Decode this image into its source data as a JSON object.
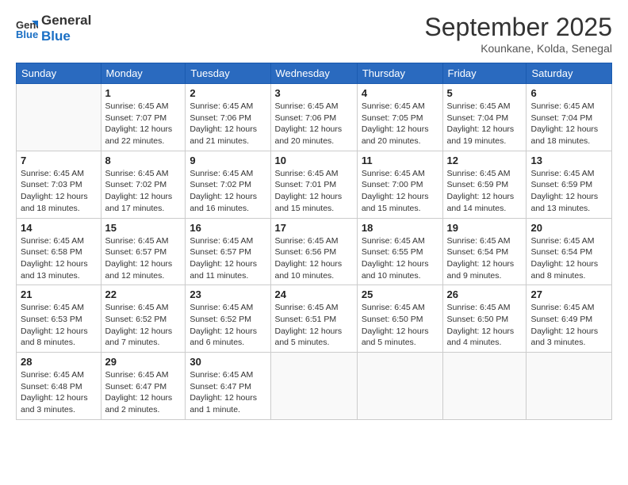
{
  "header": {
    "logo_line1": "General",
    "logo_line2": "Blue",
    "month_title": "September 2025",
    "subtitle": "Kounkane, Kolda, Senegal"
  },
  "weekdays": [
    "Sunday",
    "Monday",
    "Tuesday",
    "Wednesday",
    "Thursday",
    "Friday",
    "Saturday"
  ],
  "weeks": [
    [
      {
        "day": "",
        "info": ""
      },
      {
        "day": "1",
        "info": "Sunrise: 6:45 AM\nSunset: 7:07 PM\nDaylight: 12 hours\nand 22 minutes."
      },
      {
        "day": "2",
        "info": "Sunrise: 6:45 AM\nSunset: 7:06 PM\nDaylight: 12 hours\nand 21 minutes."
      },
      {
        "day": "3",
        "info": "Sunrise: 6:45 AM\nSunset: 7:06 PM\nDaylight: 12 hours\nand 20 minutes."
      },
      {
        "day": "4",
        "info": "Sunrise: 6:45 AM\nSunset: 7:05 PM\nDaylight: 12 hours\nand 20 minutes."
      },
      {
        "day": "5",
        "info": "Sunrise: 6:45 AM\nSunset: 7:04 PM\nDaylight: 12 hours\nand 19 minutes."
      },
      {
        "day": "6",
        "info": "Sunrise: 6:45 AM\nSunset: 7:04 PM\nDaylight: 12 hours\nand 18 minutes."
      }
    ],
    [
      {
        "day": "7",
        "info": "Sunrise: 6:45 AM\nSunset: 7:03 PM\nDaylight: 12 hours\nand 18 minutes."
      },
      {
        "day": "8",
        "info": "Sunrise: 6:45 AM\nSunset: 7:02 PM\nDaylight: 12 hours\nand 17 minutes."
      },
      {
        "day": "9",
        "info": "Sunrise: 6:45 AM\nSunset: 7:02 PM\nDaylight: 12 hours\nand 16 minutes."
      },
      {
        "day": "10",
        "info": "Sunrise: 6:45 AM\nSunset: 7:01 PM\nDaylight: 12 hours\nand 15 minutes."
      },
      {
        "day": "11",
        "info": "Sunrise: 6:45 AM\nSunset: 7:00 PM\nDaylight: 12 hours\nand 15 minutes."
      },
      {
        "day": "12",
        "info": "Sunrise: 6:45 AM\nSunset: 6:59 PM\nDaylight: 12 hours\nand 14 minutes."
      },
      {
        "day": "13",
        "info": "Sunrise: 6:45 AM\nSunset: 6:59 PM\nDaylight: 12 hours\nand 13 minutes."
      }
    ],
    [
      {
        "day": "14",
        "info": "Sunrise: 6:45 AM\nSunset: 6:58 PM\nDaylight: 12 hours\nand 13 minutes."
      },
      {
        "day": "15",
        "info": "Sunrise: 6:45 AM\nSunset: 6:57 PM\nDaylight: 12 hours\nand 12 minutes."
      },
      {
        "day": "16",
        "info": "Sunrise: 6:45 AM\nSunset: 6:57 PM\nDaylight: 12 hours\nand 11 minutes."
      },
      {
        "day": "17",
        "info": "Sunrise: 6:45 AM\nSunset: 6:56 PM\nDaylight: 12 hours\nand 10 minutes."
      },
      {
        "day": "18",
        "info": "Sunrise: 6:45 AM\nSunset: 6:55 PM\nDaylight: 12 hours\nand 10 minutes."
      },
      {
        "day": "19",
        "info": "Sunrise: 6:45 AM\nSunset: 6:54 PM\nDaylight: 12 hours\nand 9 minutes."
      },
      {
        "day": "20",
        "info": "Sunrise: 6:45 AM\nSunset: 6:54 PM\nDaylight: 12 hours\nand 8 minutes."
      }
    ],
    [
      {
        "day": "21",
        "info": "Sunrise: 6:45 AM\nSunset: 6:53 PM\nDaylight: 12 hours\nand 8 minutes."
      },
      {
        "day": "22",
        "info": "Sunrise: 6:45 AM\nSunset: 6:52 PM\nDaylight: 12 hours\nand 7 minutes."
      },
      {
        "day": "23",
        "info": "Sunrise: 6:45 AM\nSunset: 6:52 PM\nDaylight: 12 hours\nand 6 minutes."
      },
      {
        "day": "24",
        "info": "Sunrise: 6:45 AM\nSunset: 6:51 PM\nDaylight: 12 hours\nand 5 minutes."
      },
      {
        "day": "25",
        "info": "Sunrise: 6:45 AM\nSunset: 6:50 PM\nDaylight: 12 hours\nand 5 minutes."
      },
      {
        "day": "26",
        "info": "Sunrise: 6:45 AM\nSunset: 6:50 PM\nDaylight: 12 hours\nand 4 minutes."
      },
      {
        "day": "27",
        "info": "Sunrise: 6:45 AM\nSunset: 6:49 PM\nDaylight: 12 hours\nand 3 minutes."
      }
    ],
    [
      {
        "day": "28",
        "info": "Sunrise: 6:45 AM\nSunset: 6:48 PM\nDaylight: 12 hours\nand 3 minutes."
      },
      {
        "day": "29",
        "info": "Sunrise: 6:45 AM\nSunset: 6:47 PM\nDaylight: 12 hours\nand 2 minutes."
      },
      {
        "day": "30",
        "info": "Sunrise: 6:45 AM\nSunset: 6:47 PM\nDaylight: 12 hours\nand 1 minute."
      },
      {
        "day": "",
        "info": ""
      },
      {
        "day": "",
        "info": ""
      },
      {
        "day": "",
        "info": ""
      },
      {
        "day": "",
        "info": ""
      }
    ]
  ]
}
